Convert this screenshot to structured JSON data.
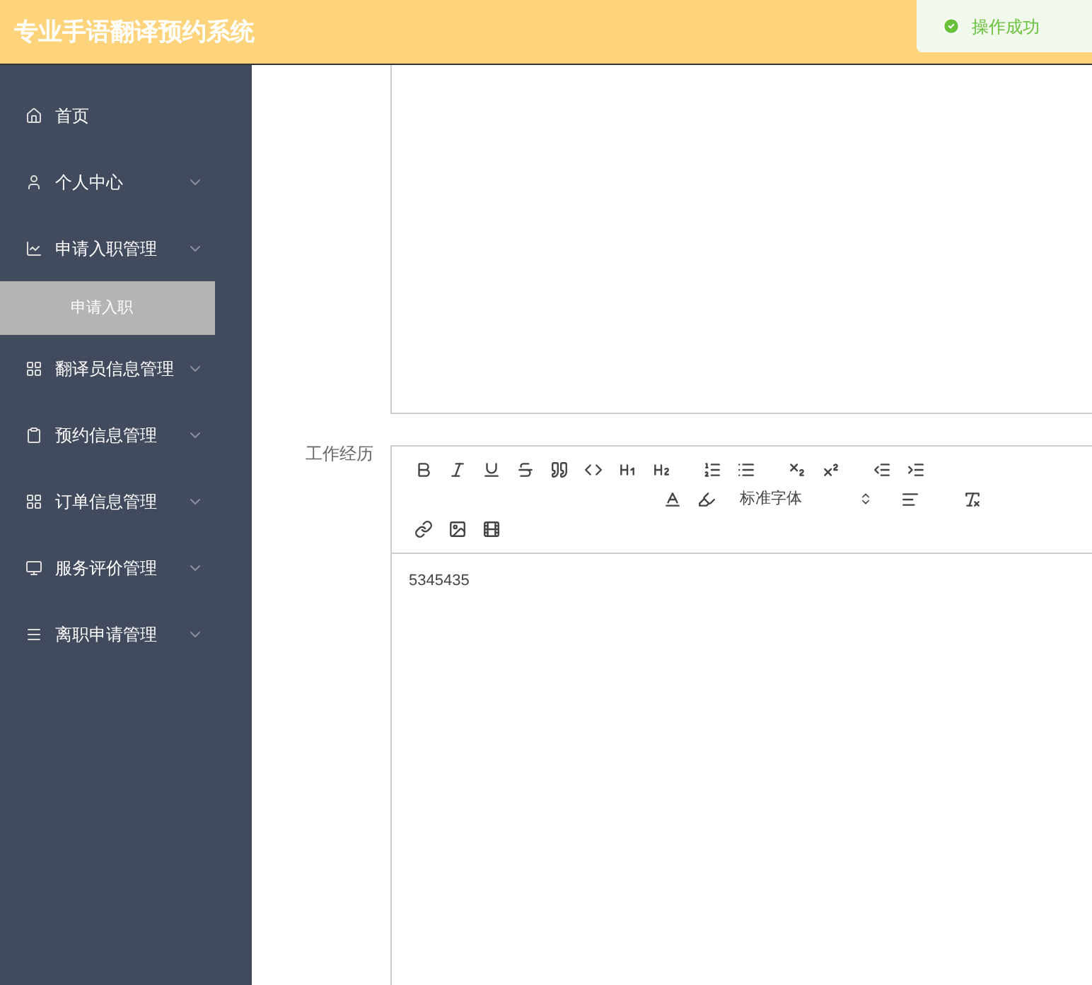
{
  "header": {
    "title": "专业手语翻译预约系统"
  },
  "toast": {
    "message": "操作成功"
  },
  "sidebar": {
    "items": [
      {
        "label": "首页",
        "expandable": false
      },
      {
        "label": "个人中心",
        "expandable": true
      },
      {
        "label": "申请入职管理",
        "expandable": true,
        "children": [
          {
            "label": "申请入职",
            "selected": true
          }
        ]
      },
      {
        "label": "翻译员信息管理",
        "expandable": true
      },
      {
        "label": "预约信息管理",
        "expandable": true
      },
      {
        "label": "订单信息管理",
        "expandable": true
      },
      {
        "label": "服务评价管理",
        "expandable": true
      },
      {
        "label": "离职申请管理",
        "expandable": true
      }
    ]
  },
  "form": {
    "field_label": "工作经历",
    "font_select": "标准字体",
    "content": "5345435"
  }
}
